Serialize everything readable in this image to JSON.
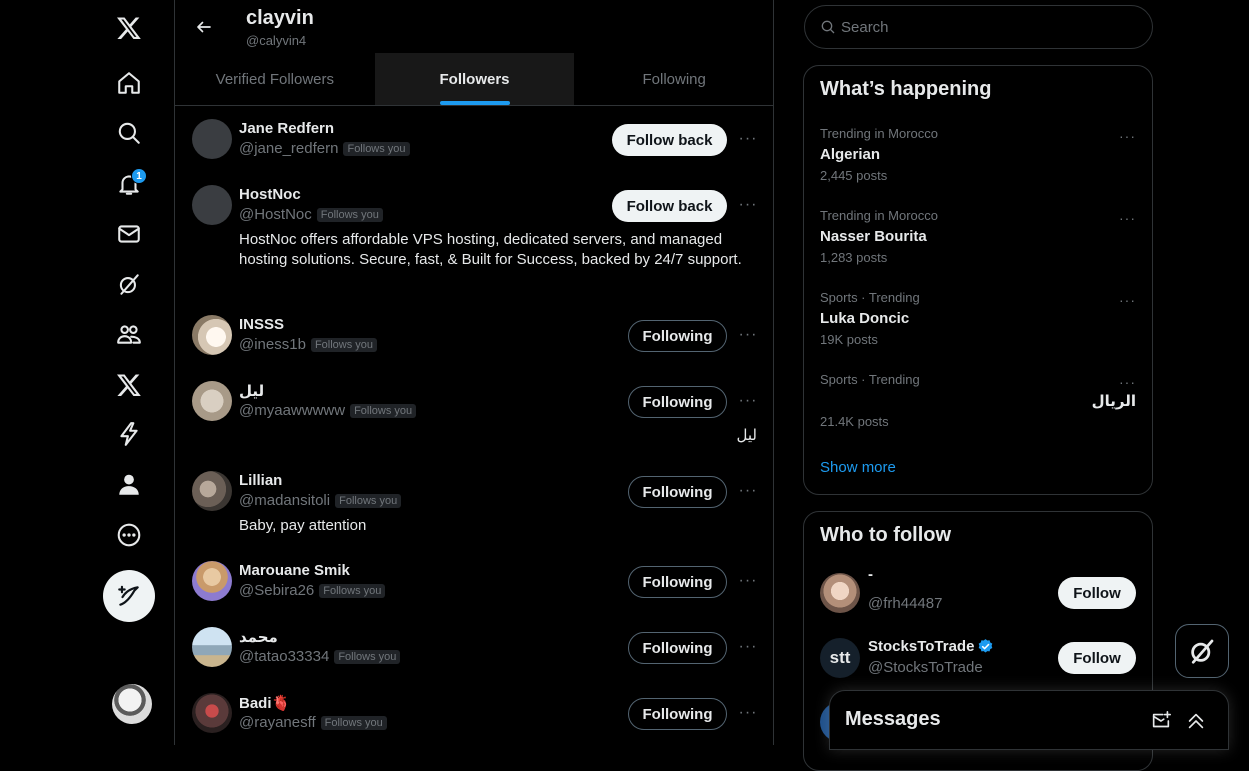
{
  "profile": {
    "name": "clayvin",
    "handle": "@calyvin4"
  },
  "tabs": [
    "Verified Followers",
    "Followers",
    "Following"
  ],
  "nav": {
    "notification_count": "1"
  },
  "followers": [
    {
      "name": "Jane Redfern",
      "handle": "@jane_redfern",
      "follows_you": "Follows you",
      "button": "Follow back",
      "bio": ""
    },
    {
      "name": "HostNoc",
      "handle": "@HostNoc",
      "follows_you": "Follows you",
      "button": "Follow back",
      "bio": "HostNoc offers affordable VPS hosting, dedicated servers, and managed hosting solutions. Secure, fast, & Built for Success, backed by 24/7 support."
    },
    {
      "name": "INSSS",
      "handle": "@iness1b",
      "follows_you": "Follows you",
      "button": "Following",
      "bio": ""
    },
    {
      "name": "ليل",
      "handle": "@myaawwwww",
      "follows_you": "Follows you",
      "button": "Following",
      "bio": "ليل"
    },
    {
      "name": "Lillian",
      "handle": "@madansitoli",
      "follows_you": "Follows you",
      "button": "Following",
      "bio": "Baby, pay attention"
    },
    {
      "name": "Marouane Smik",
      "handle": "@Sebira26",
      "follows_you": "Follows you",
      "button": "Following",
      "bio": ""
    },
    {
      "name": "محمد",
      "handle": "@tatao33334",
      "follows_you": "Follows you",
      "button": "Following",
      "bio": ""
    },
    {
      "name": "Badi🫀",
      "handle": "@rayanesff",
      "follows_you": "Follows you",
      "button": "Following",
      "bio": ""
    }
  ],
  "search": {
    "placeholder": "Search"
  },
  "trending": {
    "title": "What’s happening",
    "items": [
      {
        "meta": "Trending in Morocco",
        "topic": "Algerian",
        "count": "2,445 posts"
      },
      {
        "meta": "Trending in Morocco",
        "topic": "Nasser Bourita",
        "count": "1,283 posts"
      },
      {
        "meta": "Sports · Trending",
        "topic": "Luka Doncic",
        "count": "19K posts"
      },
      {
        "meta": "Sports · Trending",
        "topic": "الريال",
        "count": "21.4K posts"
      }
    ],
    "show_more": "Show more"
  },
  "who_to_follow": {
    "title": "Who to follow",
    "items": [
      {
        "name": "-",
        "handle": "@frh44487",
        "button": "Follow"
      },
      {
        "name": "StocksToTrade",
        "handle": "@StocksToTrade",
        "button": "Follow",
        "avatar_text": "stt"
      }
    ]
  },
  "messages": {
    "title": "Messages"
  },
  "more_glyph": "···"
}
